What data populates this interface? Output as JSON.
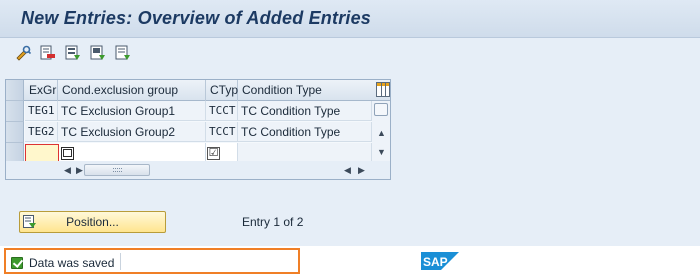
{
  "window": {
    "title": "New Entries: Overview of Added Entries"
  },
  "toolbar": {
    "buttons": [
      {
        "icon": "display-change-icon"
      },
      {
        "icon": "delete-row-icon"
      },
      {
        "icon": "select-all-icon"
      },
      {
        "icon": "select-block-icon"
      },
      {
        "icon": "deselect-all-icon"
      }
    ]
  },
  "table": {
    "columns": [
      "ExGr",
      "Cond.exclusion group",
      "CTyp",
      "Condition Type"
    ],
    "rows": [
      {
        "exgr": "TEG1",
        "group": "TC Exclusion Group1",
        "ctyp": "TCCT",
        "type": "TC Condition Type"
      },
      {
        "exgr": "TEG2",
        "group": "TC Exclusion Group2",
        "ctyp": "TCCT",
        "type": "TC Condition Type"
      }
    ],
    "new_row": {
      "exgr": "",
      "group": "",
      "ctyp": "",
      "type": ""
    }
  },
  "position_button": {
    "label": "Position..."
  },
  "entry_info": "Entry 1 of 2",
  "status": {
    "message": "Data was saved",
    "type": "success",
    "highlight_color": "#f07f26"
  },
  "brand": {
    "logo": "SAP",
    "color": "#1a8fd6"
  }
}
